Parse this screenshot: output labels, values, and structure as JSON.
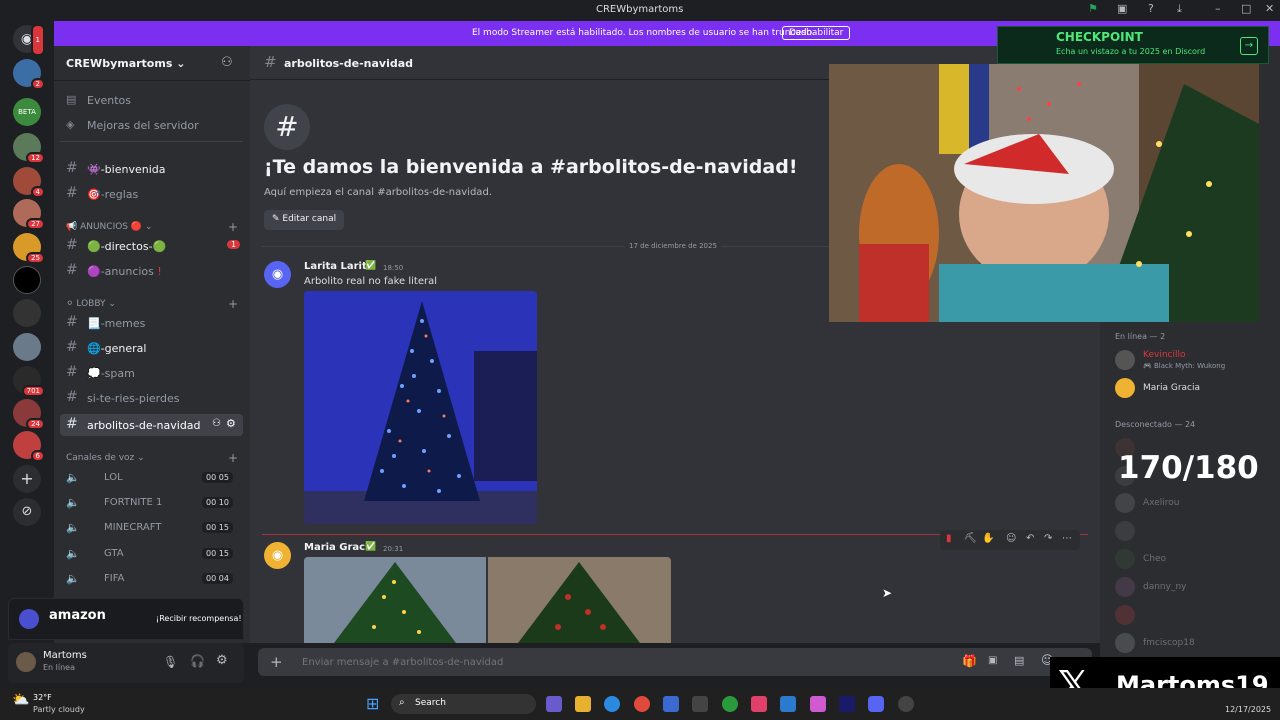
{
  "window": {
    "title": "CREWbymartoms"
  },
  "streamer_bar": {
    "message": "El modo Streamer está habilitado. Los nombres de usuario se han truncado.",
    "button": "Deshabilitar"
  },
  "checkpoint": {
    "title": "CHECKPOINT",
    "subtitle": "Echa un vistazo a tu 2025 en Discord"
  },
  "server": {
    "name": "CREWbymartoms"
  },
  "rail_badges": [
    "1",
    "2",
    "12",
    "4",
    "27",
    "25",
    "701",
    "24",
    "6"
  ],
  "sidebar": {
    "top_items": [
      {
        "label": "Eventos"
      },
      {
        "label": "Mejoras del servidor"
      }
    ],
    "channels": [
      {
        "label": "-bienvenida"
      },
      {
        "label": "-reglas"
      }
    ],
    "cat_anuncios": "ANUNCIOS",
    "anuncios": [
      {
        "label": "-directos-",
        "badge": "1"
      },
      {
        "label": "-anuncios"
      }
    ],
    "cat_lobby": "LOBBY",
    "lobby": [
      {
        "label": "-memes"
      },
      {
        "label": "-general"
      },
      {
        "label": "-spam"
      },
      {
        "label": "si-te-ries-pierdes"
      },
      {
        "label": "arbolitos-de-navidad"
      }
    ],
    "cat_voice": "Canales de voz",
    "voice": [
      {
        "label": "LOL",
        "count": "00 05"
      },
      {
        "label": "FORTNITE 1",
        "count": "00 10"
      },
      {
        "label": "MINECRAFT",
        "count": "00 15"
      },
      {
        "label": "GTA",
        "count": "00 15"
      },
      {
        "label": "FIFA",
        "count": "00 04"
      }
    ]
  },
  "amazon": {
    "brand": "amazon",
    "cta": "¡Recibir recompensa!"
  },
  "user": {
    "name": "Martoms",
    "status": "En línea"
  },
  "header": {
    "channel": "arbolitos-de-navidad"
  },
  "welcome": {
    "title": "¡Te damos la bienvenida a #arbolitos-de-navidad!",
    "subtitle": "Aquí empieza el canal #arbolitos-de-navidad.",
    "edit_button": "Editar canal"
  },
  "date_divider": "17 de diciembre de 2025",
  "messages": [
    {
      "author": "Larita Larita",
      "time": "18:50",
      "text": "Arbolito real no fake literal"
    },
    {
      "author": "Maria Gracia",
      "time": "20:31",
      "text": ""
    }
  ],
  "composer": {
    "placeholder": "Enviar mensaje a #arbolitos-de-navidad"
  },
  "members": {
    "online_header": "En línea — 2",
    "online": [
      {
        "name": "Kevincillo",
        "activity": "Black Myth: Wukong"
      },
      {
        "name": "Maria Gracia"
      }
    ],
    "offline_header": "Desconectado — 24",
    "offline": [
      "Axelirou",
      "Cheo",
      "danny_ny",
      "fmciscop18"
    ]
  },
  "overlay": {
    "counter": "170/180",
    "handle": "Martoms19"
  },
  "taskbar": {
    "weather_temp": "32°F",
    "weather_desc": "Partly cloudy",
    "search": "Search",
    "date": "12/17/2025"
  },
  "colors": {
    "accent": "#5865f2",
    "streamer": "#7b2ff0",
    "online": "#23a55a",
    "danger": "#da373c"
  }
}
